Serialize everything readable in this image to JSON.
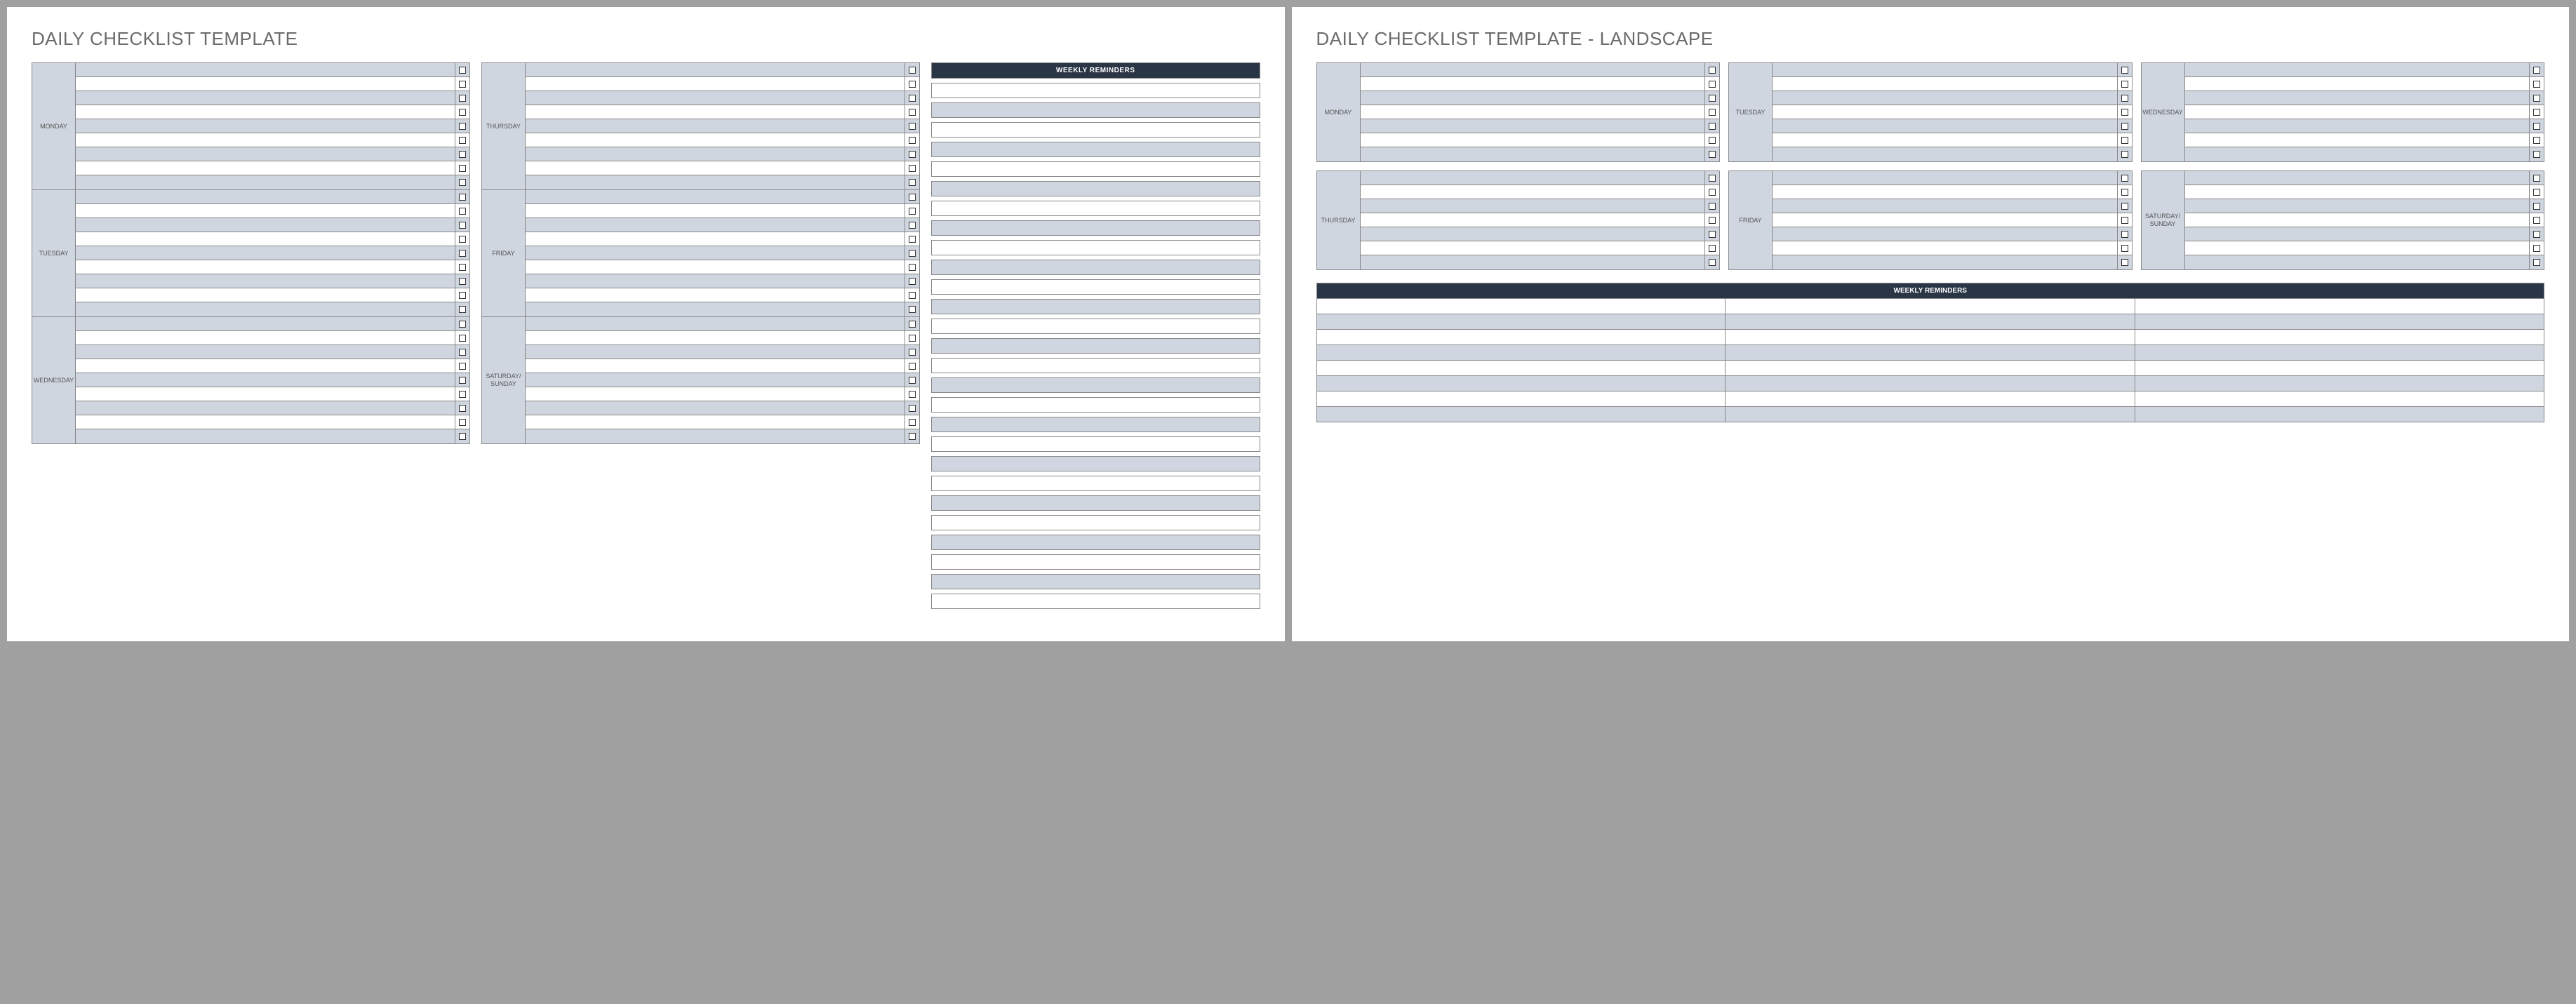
{
  "portrait": {
    "title": "DAILY CHECKLIST TEMPLATE",
    "column1_days": [
      "MONDAY",
      "TUESDAY",
      "WEDNESDAY"
    ],
    "column2_days": [
      "THURSDAY",
      "FRIDAY",
      "SATURDAY/ SUNDAY"
    ],
    "rows_per_day": 9,
    "reminders_header": "WEEKLY REMINDERS",
    "reminders_count": 27
  },
  "landscape": {
    "title": "DAILY CHECKLIST TEMPLATE - LANDSCAPE",
    "row1_days": [
      "MONDAY",
      "TUESDAY",
      "WEDNESDAY"
    ],
    "row2_days": [
      "THURSDAY",
      "FRIDAY",
      "SATURDAY/ SUNDAY"
    ],
    "rows_per_day": 7,
    "reminders_header": "WEEKLY REMINDERS",
    "reminder_rows": 8,
    "reminder_cols": 3
  }
}
